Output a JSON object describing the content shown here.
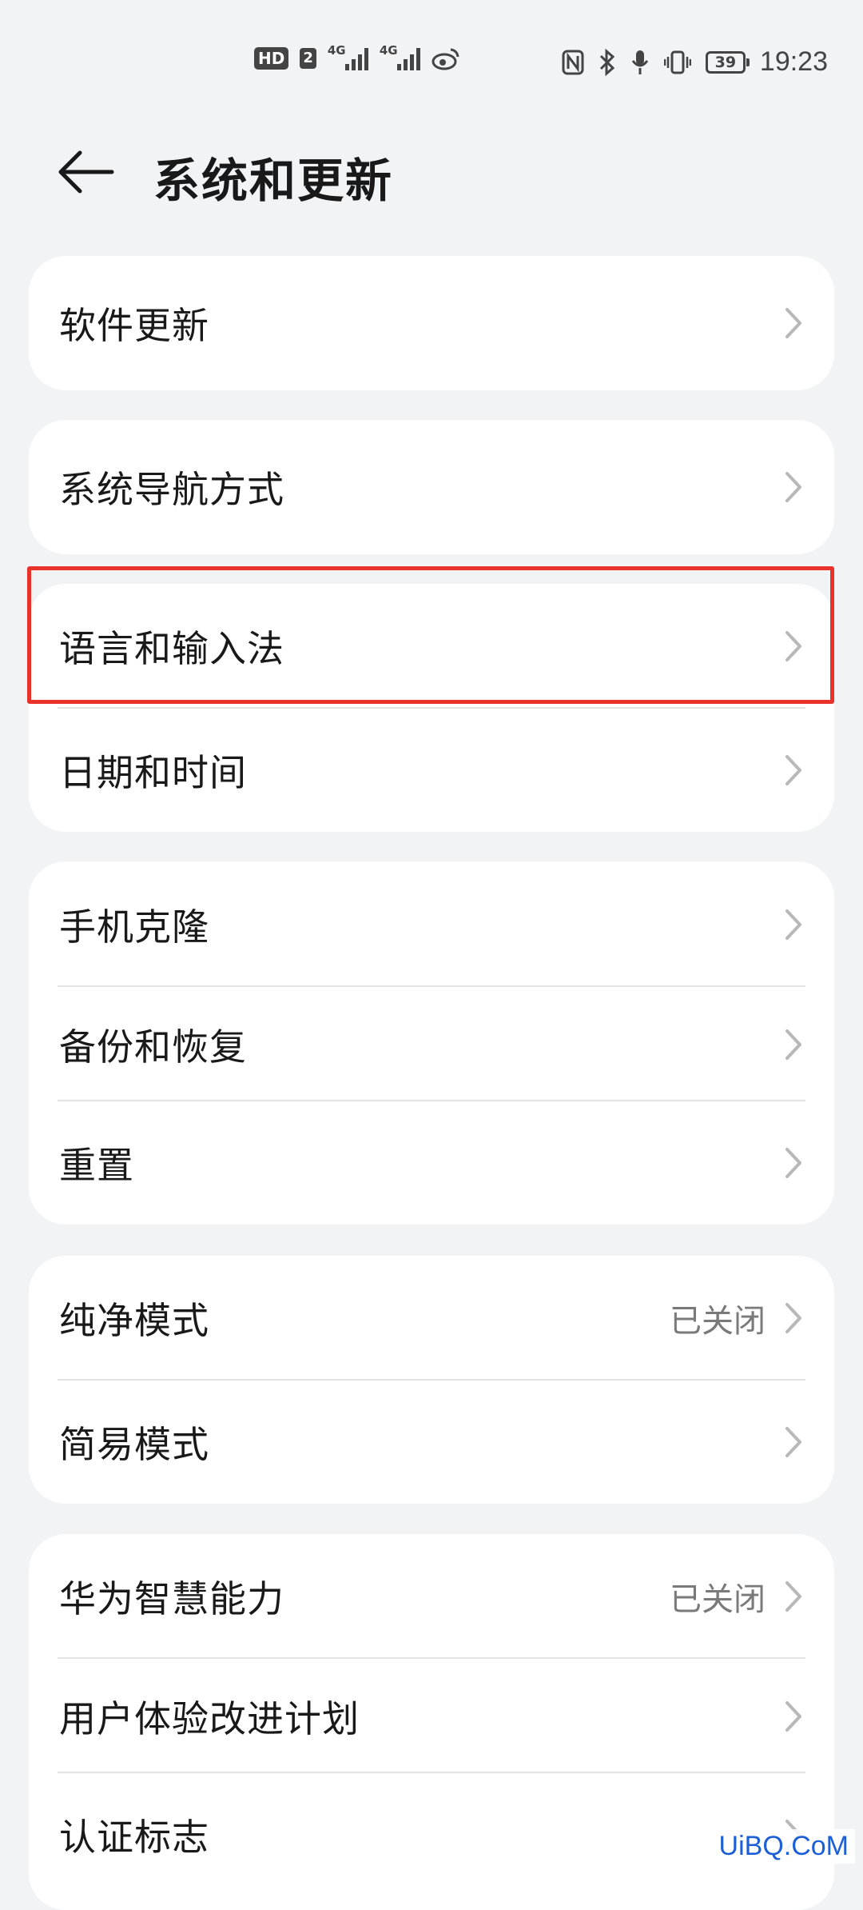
{
  "status_bar": {
    "hd": "HD",
    "sim": "2",
    "net1": "4G",
    "net2": "4G",
    "battery": "39",
    "time": "19:23"
  },
  "header": {
    "title": "系统和更新"
  },
  "groups": [
    {
      "items": [
        {
          "label": "软件更新",
          "value": ""
        }
      ]
    },
    {
      "items": [
        {
          "label": "系统导航方式",
          "value": ""
        }
      ]
    },
    {
      "items": [
        {
          "label": "语言和输入法",
          "value": ""
        },
        {
          "label": "日期和时间",
          "value": ""
        }
      ]
    },
    {
      "items": [
        {
          "label": "手机克隆",
          "value": ""
        },
        {
          "label": "备份和恢复",
          "value": ""
        },
        {
          "label": "重置",
          "value": ""
        }
      ]
    },
    {
      "items": [
        {
          "label": "纯净模式",
          "value": "已关闭"
        },
        {
          "label": "简易模式",
          "value": ""
        }
      ]
    },
    {
      "items": [
        {
          "label": "华为智慧能力",
          "value": "已关闭"
        },
        {
          "label": "用户体验改进计划",
          "value": ""
        },
        {
          "label": "认证标志",
          "value": ""
        }
      ]
    }
  ],
  "watermark": "UiBQ.CoM",
  "colors": {
    "background": "#f1f3f5",
    "card": "#ffffff",
    "highlight": "#e8322a",
    "secondary_text": "#7a7a7a"
  }
}
